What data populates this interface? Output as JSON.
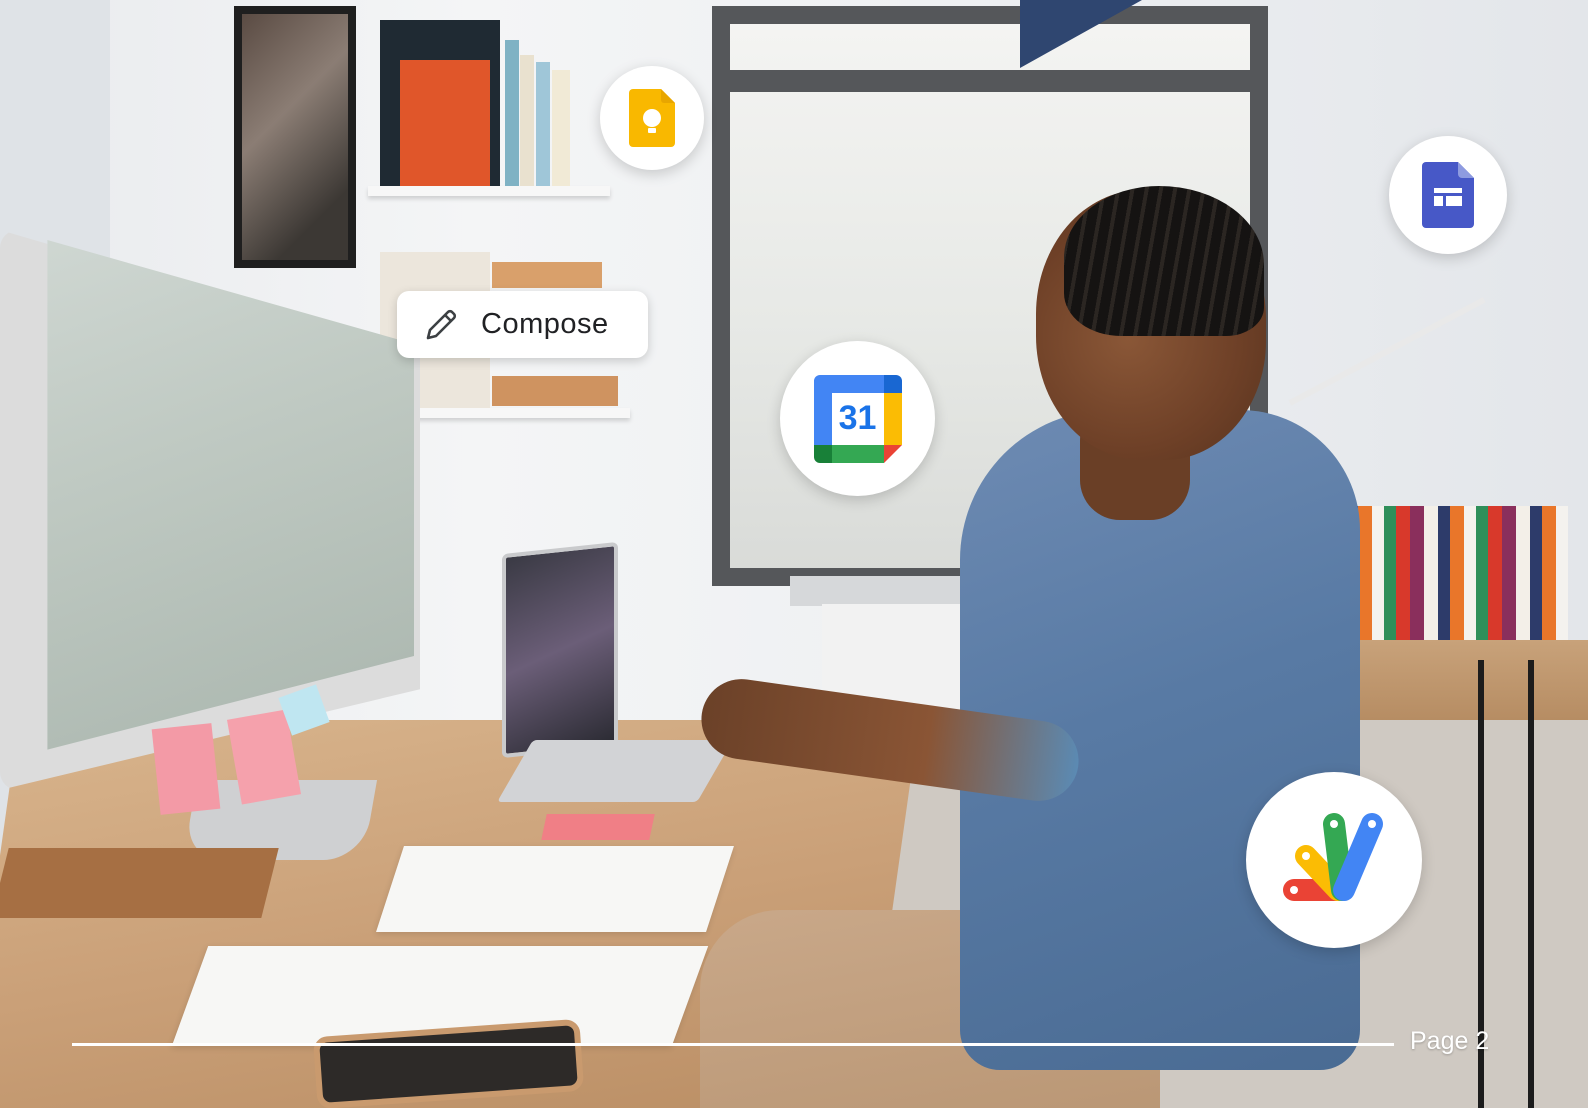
{
  "compose_chip": {
    "label": "Compose",
    "icon": "pencil-icon"
  },
  "app_icons": [
    {
      "name": "google-keep-icon",
      "color": "#F9B800"
    },
    {
      "name": "google-sites-icon",
      "color": "#4758C7"
    },
    {
      "name": "google-calendar-icon",
      "label": "31",
      "color": "#4285F4"
    },
    {
      "name": "google-apps-script-icon",
      "colors": [
        "#EA4335",
        "#FBBC04",
        "#34A853",
        "#4285F4"
      ]
    }
  ],
  "footer": {
    "page_label": "Page 2"
  },
  "colors": {
    "corner_accent": "#2F4670",
    "footer_rule": "#FFFFFF"
  }
}
